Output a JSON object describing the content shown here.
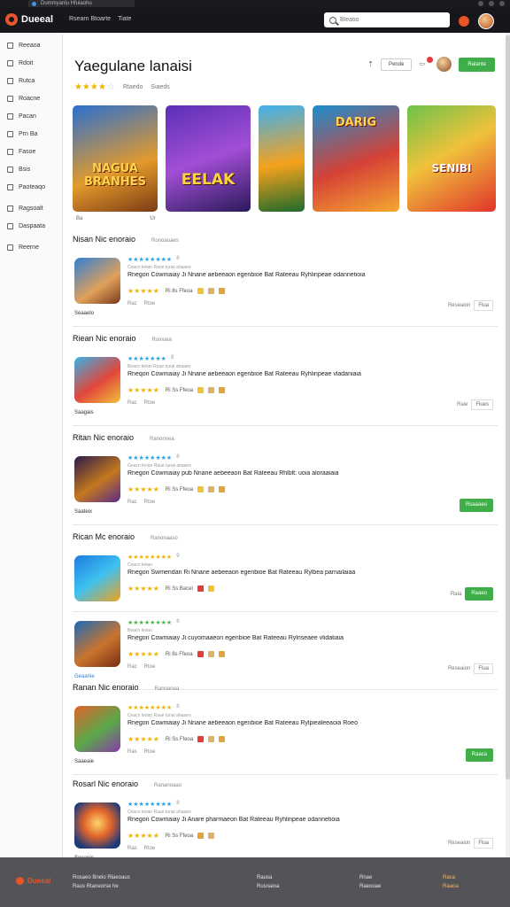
{
  "browser": {
    "tab_title": "Dummyanlu Hfulaohu"
  },
  "header": {
    "logo": "Dueeal",
    "nav": [
      "Rsearn Btoarte",
      "Tiate"
    ],
    "search_placeholder": "Bleatio"
  },
  "sidebar": {
    "items": [
      {
        "label": "Reeaoa",
        "icon": "home-icon"
      },
      {
        "label": "Rdoit",
        "icon": "star-icon"
      },
      {
        "label": "Rutca",
        "icon": "chart-icon"
      },
      {
        "label": "Roacne",
        "icon": "grid-icon"
      },
      {
        "label": "Pacan",
        "icon": "tag-icon"
      },
      {
        "label": "Prn Ba",
        "icon": "book-icon"
      },
      {
        "label": "Fasoe",
        "icon": "list-icon"
      },
      {
        "label": "Bsis",
        "icon": "folder-icon"
      },
      {
        "label": "Paoteaqo",
        "icon": "bag-icon"
      },
      {
        "label": "Ragsoalt",
        "icon": "user-icon"
      },
      {
        "label": "Daspaata",
        "icon": "gear-icon"
      },
      {
        "label": "Reerne",
        "icon": "info-icon"
      }
    ]
  },
  "page": {
    "title": "Yaegulane lanaisi",
    "meta_a": "Rtaedo",
    "meta_b": "Siaeds",
    "action_pill": "Pende",
    "action_cta": "Ralante"
  },
  "banners": [
    {
      "text": "NAGUA BRANHES"
    },
    {
      "text": "EELAK"
    },
    {
      "text": ""
    },
    {
      "text": "DARIG"
    },
    {
      "text": "SENIBI"
    }
  ],
  "banner_footer": [
    "Ba",
    "Ur"
  ],
  "sections": [
    {
      "title": "Nisan Nic enoraio",
      "subtitle": "Ronoaoaes",
      "apps": [
        {
          "name": "Seaaelo",
          "stars_count": "8",
          "line2": "Ceacn lerian Rane tunai ahaaee",
          "desc": "Rnegon Cowmaiay Ji Nnane aebeeaon egenbioe Bat Rateeau Ryhlinpeae odannetioia",
          "tag": "Ri 8s Ffeoa",
          "meta": [
            "Raz",
            "Rtoe"
          ],
          "actions": [
            "Reseaion",
            "Flua"
          ],
          "cta": ""
        }
      ]
    },
    {
      "title": "Riean Nic enoraio",
      "subtitle": "Roinoea",
      "apps": [
        {
          "name": "Saagais",
          "stars_count": "8",
          "line2": "Beacn lerian Raue tunai ahaaeo",
          "desc": "Rneqon Cowmaiay Ji Nnane aebeeaon egenbioe Bat Rateeau Ryhlinpeae vladaniaia",
          "tag": "Ri Ss Ffeoa",
          "meta": [
            "Rac",
            "Rtoe"
          ],
          "actions": [
            "Raie",
            "Flues"
          ],
          "cta": ""
        }
      ]
    },
    {
      "title": "Ritan Nic enoraio",
      "subtitle": "Ranonnea",
      "apps": [
        {
          "name": "Saateix",
          "stars_count": "8",
          "line2": "Geacn lerian Raue tunai ahaaeo",
          "desc": "Rnegon Cowmaiay pub Nnane aebeeaon Bat Rateeau Rhlblt: uoia aloraaiaia",
          "tag": "Ri Ss Ffeoa",
          "meta": [
            "Rac",
            "Rtoe"
          ],
          "actions": [],
          "cta": "Rsaaaeo"
        }
      ]
    },
    {
      "title": "Rican Mc enoraio",
      "subtitle": "Ranonaaso",
      "apps": [
        {
          "name": "",
          "stars_count": "9",
          "line2": "Ceacn lerian",
          "desc": "Rnegon Swmendan Ri Nnane aebeeaon egenbioe Bat Rateeau Rylbea parnailaiaa",
          "tag": "Ri Ss Bacel",
          "meta": [],
          "actions": [
            "Raia"
          ],
          "cta": "Raaeo"
        },
        {
          "name": "Geaanie",
          "stars_count": "8",
          "line2": "Beacn lerian",
          "desc": "Rnegon Cowmaiay Ji cuyomaaeon egenbioe Bat Rateeau Rylnseaee vlidatiaia",
          "tag": "Ri 8s Ffeoa",
          "meta": [
            "Rac",
            "Rtoe"
          ],
          "actions": [
            "Reseaion",
            "Flua"
          ],
          "cta": ""
        }
      ]
    },
    {
      "title": "Ranan Nic enoraio",
      "subtitle": "Ranoanea",
      "apps": [
        {
          "name": "Saaeaie",
          "stars_count": "8",
          "line2": "Ceacn lerian Raue tunai ahaaeo",
          "desc": "Rnegon Cowmaiay Ji Nnane aebeeaon egenbioe Bat Rateeau Rylpiealeeaoia Roeo",
          "tag": "Ri Ss Ffeoa",
          "meta": [
            "Ras",
            "Rtoe"
          ],
          "actions": [],
          "cta": "Raaca"
        }
      ]
    },
    {
      "title": "Rosarl Nic enoraio",
      "subtitle": "Rananoaao",
      "apps": [
        {
          "name": "Seeanie",
          "stars_count": "8",
          "line2": "Ceacn lerian Raue tunai ahaaeo",
          "desc": "Rnegon Cowmaiay Ji Anare pharmaeon Bat Rateeau Ryhlinpeae odannetioia",
          "tag": "Ri Ss Ffeoa",
          "meta": [
            "Ras",
            "Rtoe"
          ],
          "actions": [
            "Reseaion",
            "Flua"
          ],
          "cta": ""
        }
      ]
    }
  ],
  "footer": {
    "logo": "Dueeal",
    "col1": [
      "Rosaeo Bnelo Rlaeoaus",
      "Raus Rtaneorse he"
    ],
    "col2": [
      "Rausa",
      "Rusnaioa"
    ],
    "col3": [
      "Rnae",
      "Raeooae"
    ],
    "col4": [
      "Raca",
      "Raaoa"
    ]
  }
}
